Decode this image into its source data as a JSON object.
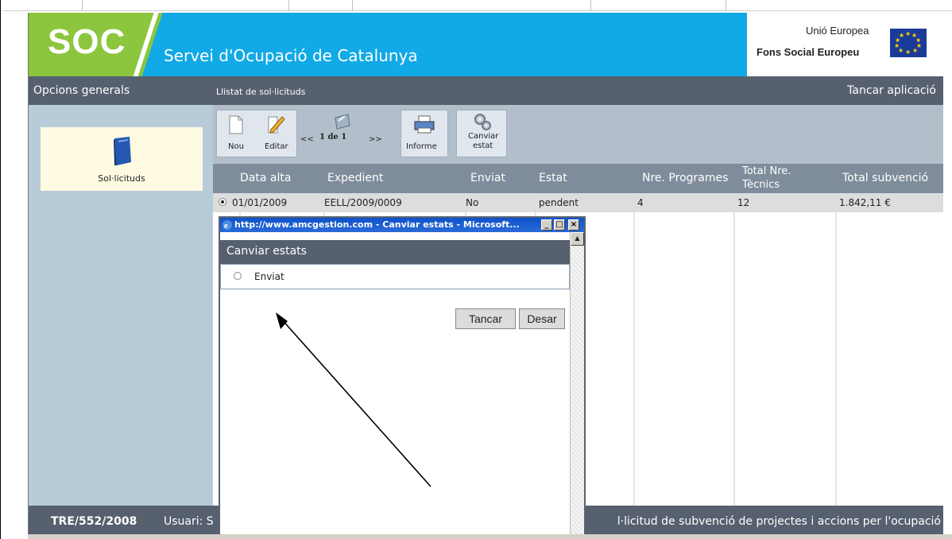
{
  "header": {
    "logo_text": "SOC",
    "org_name": "Servei d'Ocupació de Catalunya",
    "eu_line1": "Unió Europea",
    "eu_line2": "Fons Social Europeu",
    "colors": {
      "blue": "#11a9e6",
      "green": "#8cc63e",
      "eu_flag": "#1a3b9a"
    }
  },
  "navbar": {
    "left": "Opcions generals",
    "middle": "Llistat de sol·licituds",
    "right": "Tancar aplicació"
  },
  "sidebar": {
    "item_label": "Sol·licituds",
    "item_icon": "book-icon"
  },
  "toolbar": {
    "new_label": "Nou",
    "edit_label": "Editar",
    "prev_label": "<<",
    "page_label": "1 de 1",
    "next_label": ">>",
    "report_label": "Informe",
    "change_state_line1": "Canviar",
    "change_state_line2": "estat"
  },
  "grid": {
    "headers": {
      "data_alta": "Data alta",
      "expedient": "Expedient",
      "enviat": "Enviat",
      "estat": "Estat",
      "nre_programes": "Nre. Programes",
      "total_tecnics_1": "Total Nre.",
      "total_tecnics_2": "Tècnics",
      "total_subvencio": "Total subvenció"
    },
    "row": {
      "data_alta": "01/01/2009",
      "expedient": "EELL/2009/0009",
      "enviat": "No",
      "estat": "pendent",
      "nre_programes": "4",
      "total_tecnics": "12",
      "total_subvencio": "1.842,11 €"
    }
  },
  "statusbar": {
    "code": "TRE/552/2008",
    "user_label": "Usuari: S",
    "description": "l·licitud de subvenció de projectes i accions per l'ocupació"
  },
  "popup": {
    "title": "http://www.amcgestion.com - Canviar estats - Microsoft...",
    "min": "_",
    "max": "□",
    "close": "×",
    "heading": "Canviar estats",
    "option_label": "Enviat",
    "close_button": "Tancar",
    "save_button": "Desar"
  }
}
